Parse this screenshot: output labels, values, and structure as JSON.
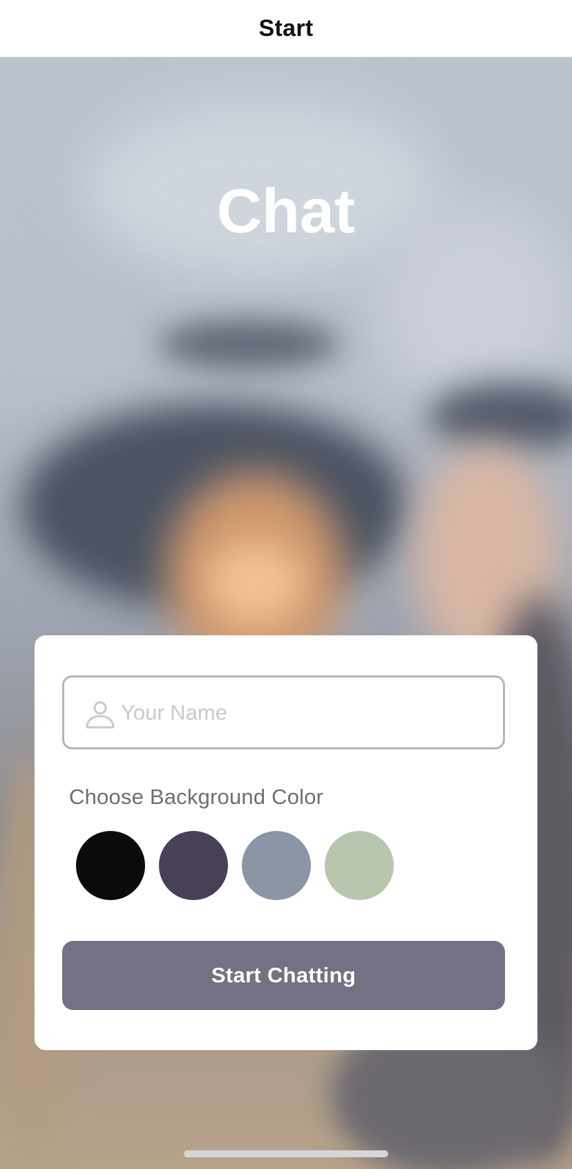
{
  "nav": {
    "title": "Start"
  },
  "app": {
    "title": "Chat"
  },
  "form": {
    "name_placeholder": "Your Name",
    "name_value": "",
    "color_label": "Choose Background Color",
    "colors": [
      "#090C08",
      "#474056",
      "#8A95A5",
      "#B9C6AE"
    ],
    "button_label": "Start Chatting",
    "button_color": "#757083"
  },
  "icons": {
    "name_field": "person-icon"
  }
}
